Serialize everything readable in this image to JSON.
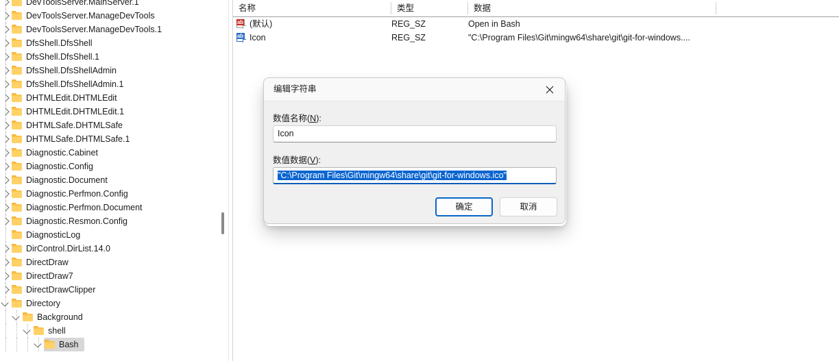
{
  "tree": {
    "items": [
      {
        "label": "DevToolsServer.MainServer.1",
        "depth": 0,
        "expander": "right"
      },
      {
        "label": "DevToolsServer.ManageDevTools",
        "depth": 0,
        "expander": "right"
      },
      {
        "label": "DevToolsServer.ManageDevTools.1",
        "depth": 0,
        "expander": "right"
      },
      {
        "label": "DfsShell.DfsShell",
        "depth": 0,
        "expander": "right"
      },
      {
        "label": "DfsShell.DfsShell.1",
        "depth": 0,
        "expander": "right"
      },
      {
        "label": "DfsShell.DfsShellAdmin",
        "depth": 0,
        "expander": "right"
      },
      {
        "label": "DfsShell.DfsShellAdmin.1",
        "depth": 0,
        "expander": "right"
      },
      {
        "label": "DHTMLEdit.DHTMLEdit",
        "depth": 0,
        "expander": "right"
      },
      {
        "label": "DHTMLEdit.DHTMLEdit.1",
        "depth": 0,
        "expander": "right"
      },
      {
        "label": "DHTMLSafe.DHTMLSafe",
        "depth": 0,
        "expander": "right"
      },
      {
        "label": "DHTMLSafe.DHTMLSafe.1",
        "depth": 0,
        "expander": "right"
      },
      {
        "label": "Diagnostic.Cabinet",
        "depth": 0,
        "expander": "right"
      },
      {
        "label": "Diagnostic.Config",
        "depth": 0,
        "expander": "right"
      },
      {
        "label": "Diagnostic.Document",
        "depth": 0,
        "expander": "right"
      },
      {
        "label": "Diagnostic.Perfmon.Config",
        "depth": 0,
        "expander": "right"
      },
      {
        "label": "Diagnostic.Perfmon.Document",
        "depth": 0,
        "expander": "right"
      },
      {
        "label": "Diagnostic.Resmon.Config",
        "depth": 0,
        "expander": "right"
      },
      {
        "label": "DiagnosticLog",
        "depth": 0,
        "expander": "none"
      },
      {
        "label": "DirControl.DirList.14.0",
        "depth": 0,
        "expander": "right"
      },
      {
        "label": "DirectDraw",
        "depth": 0,
        "expander": "right"
      },
      {
        "label": "DirectDraw7",
        "depth": 0,
        "expander": "right"
      },
      {
        "label": "DirectDrawClipper",
        "depth": 0,
        "expander": "right"
      },
      {
        "label": "Directory",
        "depth": 0,
        "expander": "down"
      },
      {
        "label": "Background",
        "depth": 1,
        "expander": "down"
      },
      {
        "label": "shell",
        "depth": 2,
        "expander": "down"
      },
      {
        "label": "Bash",
        "depth": 3,
        "expander": "down",
        "selected": true
      }
    ]
  },
  "list": {
    "columns": [
      {
        "key": "name",
        "label": "名称"
      },
      {
        "key": "type",
        "label": "类型"
      },
      {
        "key": "data",
        "label": "数据"
      }
    ],
    "rows": [
      {
        "name": "(默认)",
        "type": "REG_SZ",
        "data": "Open in Bash",
        "icon": "string-value-default-icon",
        "icon_color": "red"
      },
      {
        "name": "Icon",
        "type": "REG_SZ",
        "data": "\"C:\\Program Files\\Git\\mingw64\\share\\git\\git-for-windows....",
        "icon": "string-value-icon",
        "icon_color": "blue"
      }
    ]
  },
  "dialog": {
    "title": "编辑字符串",
    "close_icon": "close-icon",
    "value_name_label": "数值名称(N):",
    "value_name_accel": "N",
    "value_name": "Icon",
    "value_data_label": "数值数据(V):",
    "value_data_accel": "V",
    "value_data": "\"C:\\Program Files\\Git\\mingw64\\share\\git\\git-for-windows.ico\"",
    "ok_label": "确定",
    "cancel_label": "取消"
  },
  "colors": {
    "selection_blue": "#0a65d0",
    "focus_border": "#0a66c9",
    "folder_yellow": "#fcc44d",
    "tree_selected_bg": "#d7d7d7"
  }
}
